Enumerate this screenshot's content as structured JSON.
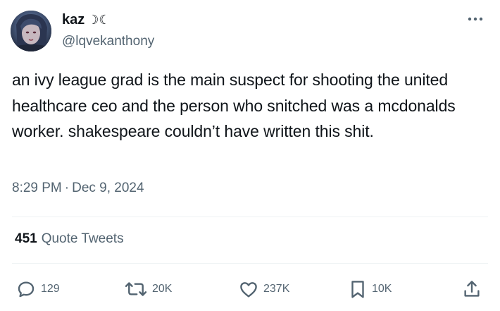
{
  "author": {
    "display_name": "kaz",
    "name_emoji": "☽☾",
    "handle": "@lqvekanthony"
  },
  "tweet": {
    "text": "an ivy league grad is the main suspect for shooting the united healthcare ceo and the person who snitched was a mcdonalds worker. shakespeare couldn’t have written this shit.",
    "time": "8:29 PM",
    "separator": "·",
    "date": "Dec 9, 2024"
  },
  "quote_tweets": {
    "count": "451",
    "label": "Quote Tweets"
  },
  "actions": {
    "replies": "129",
    "retweets": "20K",
    "likes": "237K",
    "bookmarks": "10K"
  },
  "colors": {
    "text": "#0f1419",
    "secondary": "#536471",
    "divider": "#eff3f4"
  },
  "icons": [
    "more-icon",
    "reply-icon",
    "retweet-icon",
    "like-icon",
    "bookmark-icon",
    "share-icon"
  ]
}
